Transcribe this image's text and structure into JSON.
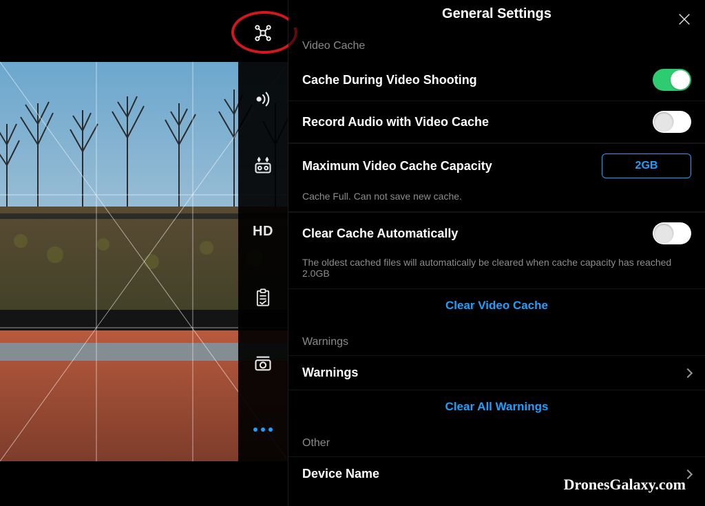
{
  "header": {
    "title": "General Settings"
  },
  "section_video_cache": "Video Cache",
  "rows": {
    "cache_during": {
      "label": "Cache During Video Shooting",
      "toggle": true
    },
    "record_audio": {
      "label": "Record Audio with Video Cache",
      "toggle": false
    },
    "max_capacity": {
      "label": "Maximum Video Cache Capacity",
      "value": "2GB",
      "note": "Cache Full. Can not save new cache."
    },
    "clear_auto": {
      "label": "Clear Cache Automatically",
      "toggle": false,
      "note": "The oldest cached files will automatically be cleared when cache capacity has reached 2.0GB"
    }
  },
  "actions": {
    "clear_video_cache": "Clear Video Cache",
    "clear_all_warnings": "Clear All Warnings"
  },
  "section_warnings": "Warnings",
  "rows_warnings": {
    "label": "Warnings"
  },
  "section_other": "Other",
  "rows_other": {
    "device_name": "Device Name"
  },
  "rail_icons": [
    "drone-icon",
    "signal-icon",
    "controller-icon",
    "hd-icon",
    "clipboard-icon",
    "camera-icon",
    "more-icon"
  ],
  "watermark": "DronesGalaxy.com"
}
